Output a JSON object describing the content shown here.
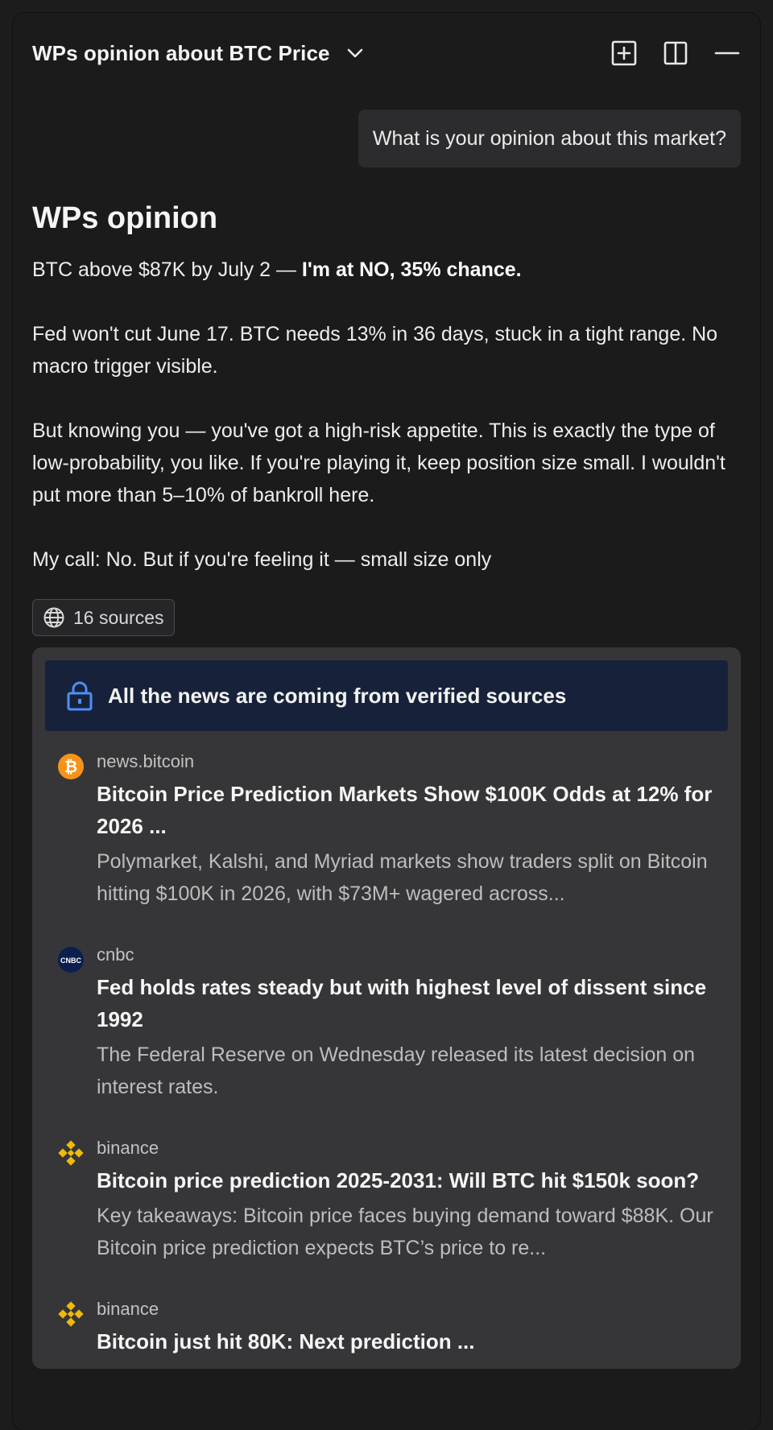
{
  "header": {
    "title": "WPs opinion about BTC Price",
    "actions": [
      "new-chat-icon",
      "split-view-icon",
      "minimize-icon"
    ]
  },
  "user_message": "What is your opinion about this market?",
  "answer": {
    "title": "WPs opinion",
    "line1_prefix": "BTC above $87K by July 2 — ",
    "line1_bold": "I'm at NO, 35% chance.",
    "para2": "Fed won't cut June 17. BTC needs 13% in 36 days, stuck in a tight range. No macro trigger visible.",
    "para3": "But knowing you — you've got a high-risk appetite. This is exactly the type of low-probability, you like. If you're playing it, keep position size small. I wouldn't put more than 5–10% of bankroll here.",
    "para4": "My call: No. But if you're feeling it — small size only"
  },
  "sources": {
    "chip_label": "16 sources",
    "banner": "All the news are coming from verified sources",
    "items": [
      {
        "source": "news.bitcoin",
        "logo": "bitcoin-logo-icon",
        "title": "Bitcoin Price Prediction Markets Show $100K Odds at 12% for 2026 ...",
        "snippet": "Polymarket, Kalshi, and Myriad markets show traders split on Bitcoin hitting $100K in 2026, with $73M+ wagered across..."
      },
      {
        "source": "cnbc",
        "logo": "cnbc-logo-icon",
        "title": "Fed holds rates steady but with highest level of dissent since 1992",
        "snippet": "The Federal Reserve on Wednesday released its latest decision on interest rates."
      },
      {
        "source": "binance",
        "logo": "binance-logo-icon",
        "title": "Bitcoin price prediction 2025-2031: Will BTC hit $150k soon?",
        "snippet": "Key takeaways: Bitcoin price faces buying demand toward $88K. Our Bitcoin price prediction expects BTC’s price to re..."
      },
      {
        "source": "binance",
        "logo": "binance-logo-icon",
        "title": "Bitcoin just hit 80K: Next prediction ...",
        "snippet": ""
      }
    ]
  },
  "colors": {
    "background": "#1b1b1c",
    "bubble": "#2c2c2e",
    "sources_panel": "#363638",
    "banner": "#17223a",
    "lock_icon": "#4d8ff5",
    "bitcoin_orange": "#f7931a",
    "binance_yellow": "#f0b90b",
    "cnbc_navy": "#0b1f4f"
  }
}
